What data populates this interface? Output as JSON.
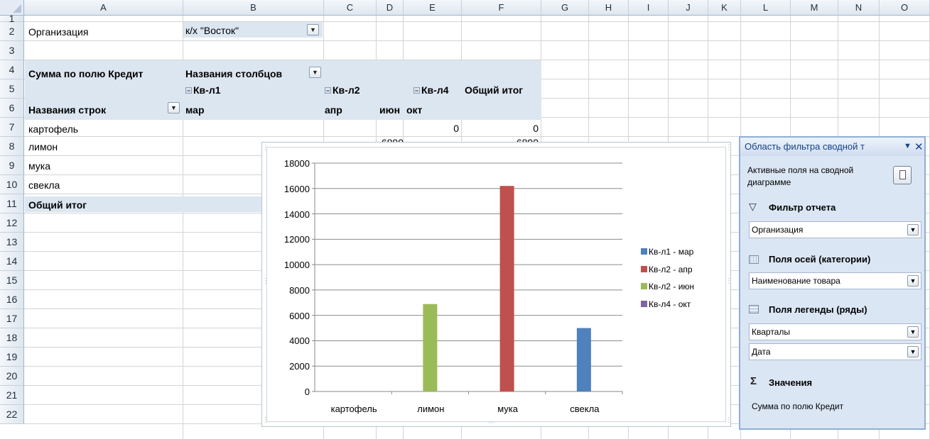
{
  "columns": [
    "A",
    "B",
    "C",
    "D",
    "E",
    "F",
    "G",
    "H",
    "I",
    "J",
    "K",
    "L",
    "M",
    "N",
    "O"
  ],
  "rows": [
    "1",
    "2",
    "3",
    "4",
    "5",
    "6",
    "7",
    "8",
    "9",
    "10",
    "11",
    "12",
    "13",
    "14",
    "15",
    "16",
    "17",
    "18",
    "19",
    "20",
    "21",
    "22"
  ],
  "cells": {
    "a1": "Организация",
    "b1": "к/х \"Восток\"",
    "a3": "Сумма по полю Кредит",
    "b3": "Названия столбцов",
    "b4": "Кв-л1",
    "c4": "Кв-л2",
    "e4": "Кв-л4",
    "f4": "Общий итог",
    "a5": "Названия строк",
    "b5": "мар",
    "c5": "апр",
    "d5": "июн",
    "e5": "окт",
    "a6": "картофель",
    "e6": "0",
    "f6": "0",
    "a7": "лимон",
    "d7": "6890",
    "f7": "6890",
    "a8": "мука",
    "a9": "свекла",
    "a10": "Общий итог"
  },
  "chart_data": {
    "type": "bar",
    "categories": [
      "картофель",
      "лимон",
      "мука",
      "свекла"
    ],
    "series": [
      {
        "name": "Кв-л1 - мар",
        "color": "#4f81bd",
        "values": [
          null,
          null,
          null,
          5000
        ]
      },
      {
        "name": "Кв-л2 - апр",
        "color": "#c0504d",
        "values": [
          null,
          null,
          16200,
          null
        ]
      },
      {
        "name": "Кв-л2 - июн",
        "color": "#9bbb59",
        "values": [
          null,
          6890,
          null,
          null
        ]
      },
      {
        "name": "Кв-л4 - окт",
        "color": "#8064a2",
        "values": [
          0,
          null,
          null,
          null
        ]
      }
    ],
    "yticks": [
      "0",
      "2000",
      "4000",
      "6000",
      "8000",
      "10000",
      "12000",
      "14000",
      "16000",
      "18000"
    ],
    "ylim": [
      0,
      18000
    ],
    "grid": true,
    "legend": "right"
  },
  "pane": {
    "title": "Область фильтра сводной т",
    "active_fields_1": "Активные поля на сводной",
    "active_fields_2": "диаграмме",
    "report_filter": "Фильтр отчета",
    "report_filter_value": "Организация",
    "axis_fields": "Поля осей (категории)",
    "axis_value": "Наименование товара",
    "legend_fields": "Поля легенды (ряды)",
    "legend_value_1": "Кварталы",
    "legend_value_2": "Дата",
    "values": "Значения",
    "values_value": "Сумма по полю Кредит"
  }
}
